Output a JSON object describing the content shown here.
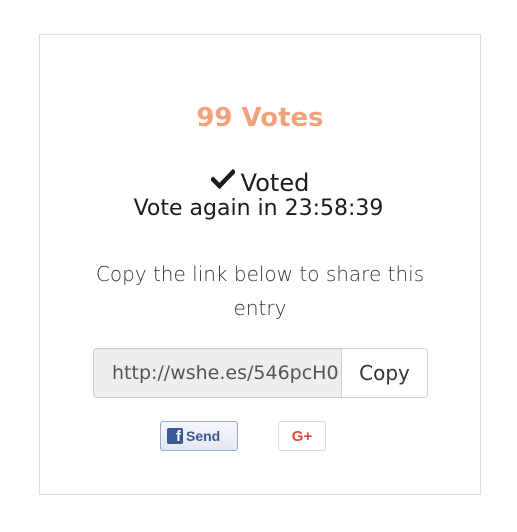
{
  "votes": {
    "count_text": "99 Votes",
    "color": "#f2a27b"
  },
  "status": {
    "voted_label": "Voted",
    "vote_again_text": "Vote again in 23:58:39"
  },
  "share": {
    "instructions": "Copy the link below to share this entry",
    "link_value": "http://wshe.es/546pcH0",
    "copy_label": "Copy"
  },
  "social": {
    "facebook_icon": "f",
    "facebook_label": "Send",
    "facebook_color": "#3b5998",
    "gplus_label": "G+",
    "gplus_color": "#dd4b39"
  }
}
